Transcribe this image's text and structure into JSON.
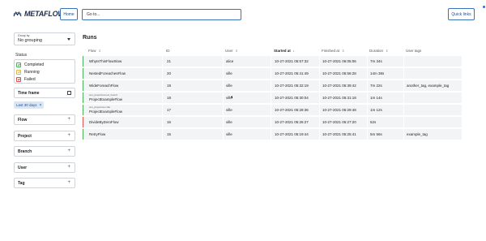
{
  "header": {
    "logo_text": "METAFLOW",
    "home_label": "Home",
    "goto_placeholder": "Go to...",
    "quick_links_label": "Quick links"
  },
  "sidebar": {
    "group_by_label": "Group by",
    "group_by_value": "No grouping",
    "status_title": "Status",
    "statuses": [
      {
        "label": "Completed",
        "state": "completed"
      },
      {
        "label": "Running",
        "state": "running"
      },
      {
        "label": "Failed",
        "state": "failed"
      }
    ],
    "time_frame_label": "Time frame",
    "time_chip": "Last 30 days",
    "time_chip_clear": "×",
    "filters": [
      {
        "label": "Flow",
        "action": "+"
      },
      {
        "label": "Project",
        "action": "+"
      },
      {
        "label": "Branch",
        "action": "+"
      },
      {
        "label": "User",
        "action": "+"
      },
      {
        "label": "Tag",
        "action": "+"
      }
    ]
  },
  "main": {
    "title": "Runs",
    "columns": [
      {
        "label": "Flow",
        "sort": "⇕",
        "active": false
      },
      {
        "label": "ID",
        "sort": "",
        "active": false
      },
      {
        "label": "User",
        "sort": "⇕",
        "active": false
      },
      {
        "label": "Started at",
        "sort": "↓",
        "active": true
      },
      {
        "label": "Finished at",
        "sort": "⇕",
        "active": false
      },
      {
        "label": "Duration",
        "sort": "⇕",
        "active": false
      },
      {
        "label": "User tags",
        "sort": "",
        "active": false
      }
    ],
    "rows": [
      {
        "project": "",
        "flow": "WhyIsThisFlowSlow",
        "id": "21",
        "user": "alice",
        "started": "10-27-2021 05:57:32",
        "finished": "10-27-2021 06:05:06",
        "duration": "7m 34s",
        "tags": "",
        "status": "completed"
      },
      {
        "project": "",
        "flow": "NestedForeachesFlow",
        "id": "20",
        "user": "ville",
        "started": "10-27-2021 05:41:49",
        "finished": "10-27-2021 05:56:28",
        "duration": "14m 38s",
        "tags": "",
        "status": "completed"
      },
      {
        "project": "",
        "flow": "WideForeachFlow",
        "id": "19",
        "user": "ville",
        "started": "10-27-2021 05:32:19",
        "finished": "10-27-2021 05:39:42",
        "duration": "7m 22s",
        "tags": "another_tag, example_tag",
        "status": "completed"
      },
      {
        "project": "test_project/test.test_branch",
        "flow": "ProjectExampleFlow",
        "id": "18",
        "user": "ville",
        "started": "10-27-2021 05:30:04",
        "finished": "10-27-2021 05:31:18",
        "duration": "1m 14s",
        "tags": "",
        "status": "completed"
      },
      {
        "project": "test_project/user.ville",
        "flow": "ProjectExampleFlow",
        "id": "17",
        "user": "ville",
        "started": "10-27-2021 05:28:36",
        "finished": "10-27-2021 05:29:48",
        "duration": "1m 12s",
        "tags": "",
        "status": "completed"
      },
      {
        "project": "",
        "flow": "DivideByZeroFlow",
        "id": "16",
        "user": "ville",
        "started": "10-27-2021 05:26:27",
        "finished": "10-27-2021 05:27:20",
        "duration": "52s",
        "tags": "",
        "status": "failed"
      },
      {
        "project": "",
        "flow": "RetryFlow",
        "id": "15",
        "user": "ville",
        "started": "10-27-2021 05:19:44",
        "finished": "10-27-2021 05:25:41",
        "duration": "5m 56s",
        "tags": "example_tag",
        "status": "completed"
      }
    ]
  },
  "colors": {
    "completed": "#49b05c",
    "failed": "#d9534f",
    "running": "#e0b94a",
    "accent": "#3a72b8"
  }
}
